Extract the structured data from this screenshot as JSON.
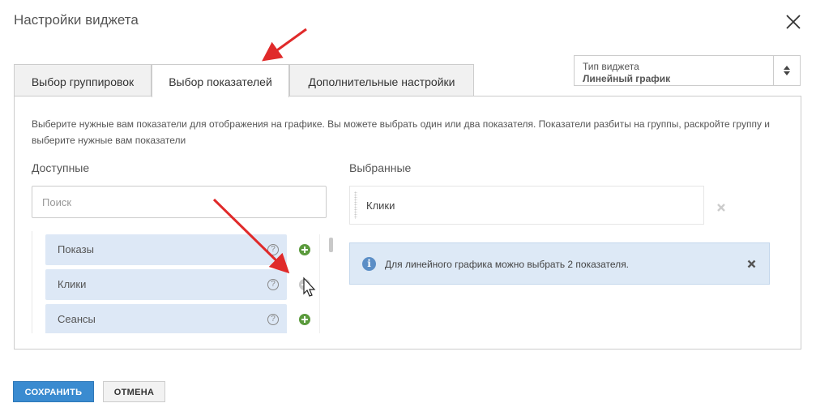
{
  "dialog": {
    "title": "Настройки виджета",
    "close_icon": "close-x-icon"
  },
  "widget_type": {
    "label": "Тип виджета",
    "value": "Линейный график",
    "icon": "updown-arrows-icon"
  },
  "tabs": [
    {
      "label": "Выбор группировок",
      "active": false
    },
    {
      "label": "Выбор показателей",
      "active": true
    },
    {
      "label": "Дополнительные настройки",
      "active": false
    }
  ],
  "panel": {
    "description": "Выберите нужные вам показатели для отображения на графике. Вы можете выбрать один или два показателя. Показатели разбиты на группы, раскройте группу и выберите нужные вам показатели",
    "available_heading": "Доступные",
    "selected_heading": "Выбранные",
    "search_placeholder": "Поиск",
    "available_items": [
      {
        "label": "Показы",
        "help": "?",
        "add_enabled": true
      },
      {
        "label": "Клики",
        "help": "?",
        "add_enabled": false
      },
      {
        "label": "Сеансы",
        "help": "?",
        "add_enabled": true
      }
    ],
    "selected_items": [
      {
        "label": "Клики"
      }
    ],
    "info": {
      "icon_glyph": "i",
      "text": "Для линейного графика можно выбрать 2 показателя."
    }
  },
  "buttons": {
    "save": "СОХРАНИТЬ",
    "cancel": "ОТМЕНА"
  },
  "colors": {
    "accent": "#3a8bd0",
    "annotation_arrow": "#e02a2a",
    "add_icon": "#5a9a3c"
  }
}
